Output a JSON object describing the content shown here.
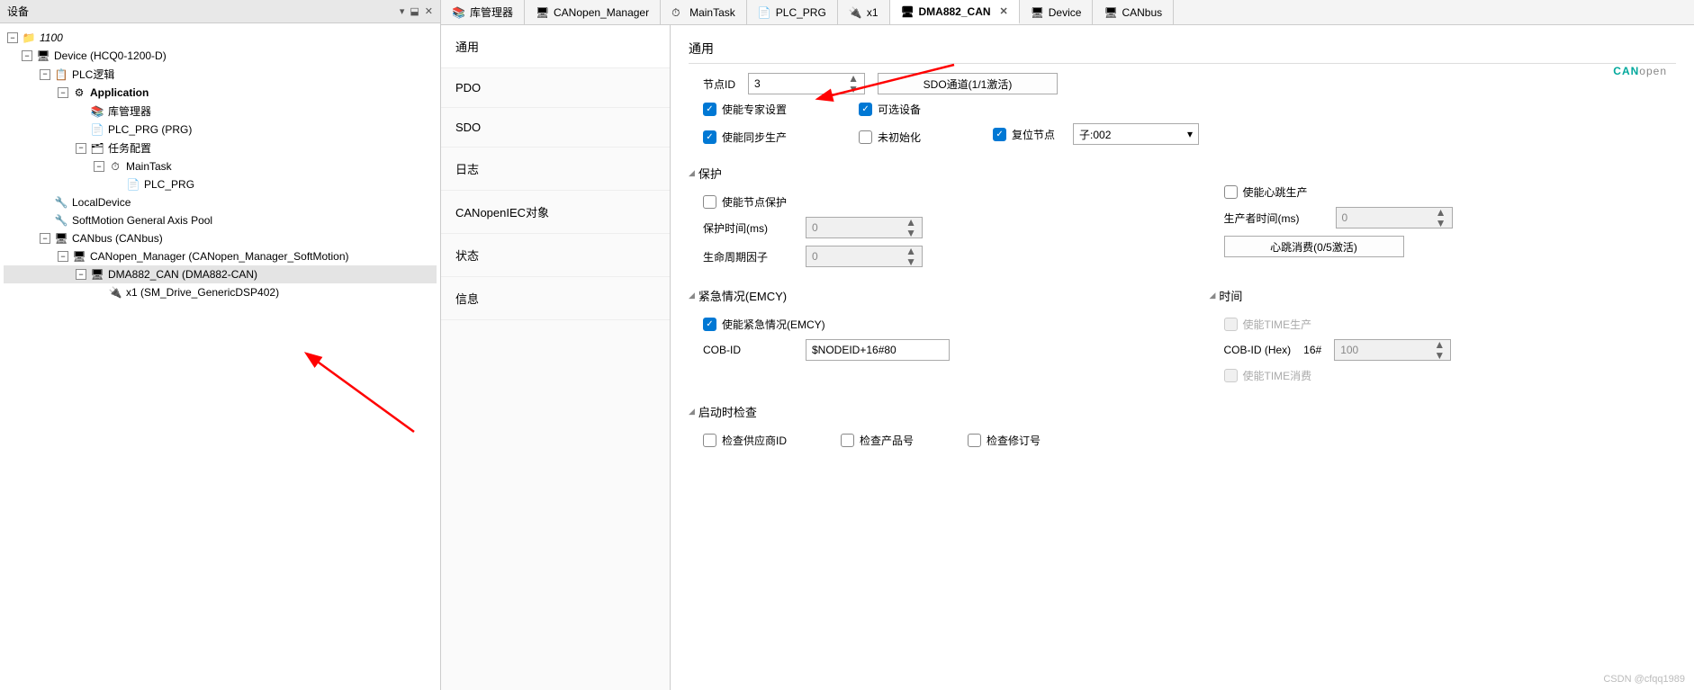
{
  "leftPanel": {
    "title": "设备",
    "tree": {
      "root": "1100",
      "device": "Device (HCQ0-1200-D)",
      "plcLogic": "PLC逻辑",
      "application": "Application",
      "libManager": "库管理器",
      "plcPrg": "PLC_PRG (PRG)",
      "taskConfig": "任务配置",
      "mainTask": "MainTask",
      "plcPrg2": "PLC_PRG",
      "localDevice": "LocalDevice",
      "softMotion": "SoftMotion General Axis Pool",
      "canbus": "CANbus (CANbus)",
      "canopenMgr": "CANopen_Manager (CANopen_Manager_SoftMotion)",
      "dma882": "DMA882_CAN (DMA882-CAN)",
      "x1": "x1 (SM_Drive_GenericDSP402)"
    }
  },
  "tabs": [
    {
      "label": "库管理器"
    },
    {
      "label": "CANopen_Manager"
    },
    {
      "label": "MainTask"
    },
    {
      "label": "PLC_PRG"
    },
    {
      "label": "x1"
    },
    {
      "label": "DMA882_CAN",
      "active": true
    },
    {
      "label": "Device"
    },
    {
      "label": "CANbus"
    }
  ],
  "sidenav": [
    {
      "label": "通用",
      "active": true
    },
    {
      "label": "PDO"
    },
    {
      "label": "SDO"
    },
    {
      "label": "日志"
    },
    {
      "label": "CANopenIEC对象"
    },
    {
      "label": "状态"
    },
    {
      "label": "信息"
    }
  ],
  "general": {
    "title": "通用",
    "nodeIdLabel": "节点ID",
    "nodeId": "3",
    "sdoChannel": "SDO通道(1/1激活)",
    "enableExpert": "使能专家设置",
    "optionalDevice": "可选设备",
    "enableSync": "使能同步生产",
    "uninitialized": "未初始化",
    "resetNode": "复位节点",
    "subSelect": "子:002"
  },
  "protection": {
    "title": "保护",
    "enableNodeProtect": "使能节点保护",
    "protectTimeLabel": "保护时间(ms)",
    "protectTime": "0",
    "lifeCycleLabel": "生命周期因子",
    "lifeCycle": "0",
    "enableHeartbeat": "使能心跳生产",
    "producerTimeLabel": "生产者时间(ms)",
    "producerTime": "0",
    "heartbeatConsume": "心跳消费(0/5激活)"
  },
  "emcy": {
    "title": "紧急情况(EMCY)",
    "enable": "使能紧急情况(EMCY)",
    "cobIdLabel": "COB-ID",
    "cobId": "$NODEID+16#80"
  },
  "time": {
    "title": "时间",
    "enableProduce": "使能TIME生产",
    "cobIdLabel": "COB-ID (Hex)",
    "hex": "16#",
    "cobId": "100",
    "enableConsume": "使能TIME消费"
  },
  "startup": {
    "title": "启动时检查",
    "checkVendor": "检查供应商ID",
    "checkProduct": "检查产品号",
    "checkRevision": "检查修订号"
  },
  "watermark": "CSDN @cfqq1989"
}
